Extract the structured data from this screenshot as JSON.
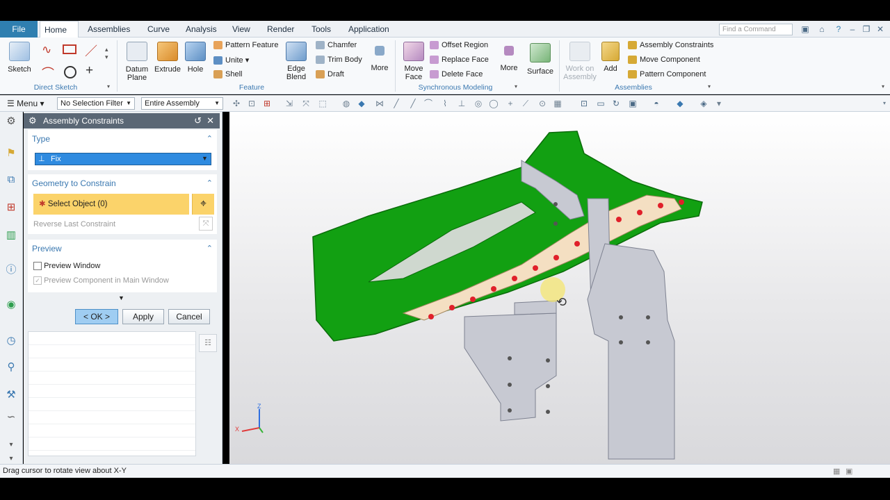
{
  "menu": {
    "file": "File",
    "tabs": [
      "Home",
      "Assemblies",
      "Curve",
      "Analysis",
      "View",
      "Render",
      "Tools",
      "Application"
    ],
    "search_placeholder": "Find a Command"
  },
  "ribbon": {
    "sketch": "Sketch",
    "direct_sketch": "Direct Sketch",
    "datum_plane": "Datum Plane",
    "extrude": "Extrude",
    "hole": "Hole",
    "pattern_feature": "Pattern Feature",
    "unite": "Unite",
    "shell": "Shell",
    "edge_blend": "Edge Blend",
    "chamfer": "Chamfer",
    "trim_body": "Trim Body",
    "draft": "Draft",
    "more": "More",
    "feature": "Feature",
    "move_face": "Move Face",
    "offset_region": "Offset Region",
    "replace_face": "Replace Face",
    "delete_face": "Delete Face",
    "sync_more": "More",
    "synchronous_modeling": "Synchronous Modeling",
    "surface": "Surface",
    "work_on_assembly": "Work on Assembly",
    "add": "Add",
    "assembly_constraints": "Assembly Constraints",
    "move_component": "Move Component",
    "pattern_component": "Pattern Component",
    "assemblies": "Assemblies"
  },
  "toolbar": {
    "menu": "Menu",
    "selection_filter": "No Selection Filter",
    "scope": "Entire Assembly"
  },
  "dialog": {
    "title": "Assembly Constraints",
    "type_section": "Type",
    "type_value": "Fix",
    "geometry_section": "Geometry to Constrain",
    "select_object": "Select Object (0)",
    "reverse_last": "Reverse Last Constraint",
    "preview_section": "Preview",
    "preview_window": "Preview Window",
    "preview_component": "Preview Component in Main Window",
    "ok": "< OK >",
    "apply": "Apply",
    "cancel": "Cancel"
  },
  "triad": {
    "z": "Z",
    "x": "X"
  },
  "status": {
    "message": "Drag cursor to rotate view about X-Y"
  },
  "colors": {
    "accent": "#2f7fb0",
    "fixture_green": "#12a012",
    "highlight": "#fbd36a",
    "part_gray": "#c7c9d2",
    "pin_red": "#e0202a"
  }
}
